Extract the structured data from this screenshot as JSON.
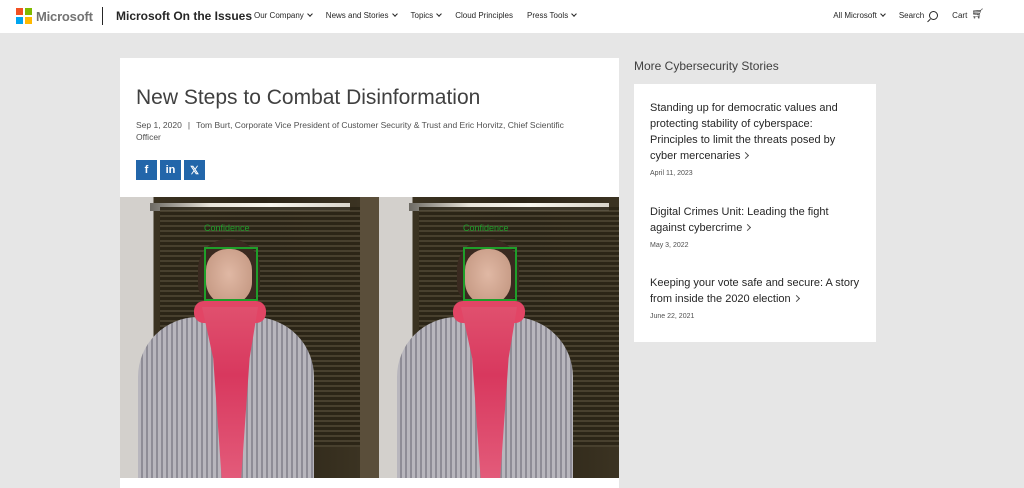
{
  "header": {
    "brand": "Microsoft",
    "site_title": "Microsoft On the Issues",
    "nav": [
      {
        "label": "Our Company",
        "dropdown": true
      },
      {
        "label": "News and Stories",
        "dropdown": true
      },
      {
        "label": "Topics",
        "dropdown": true
      },
      {
        "label": "Cloud Principles",
        "dropdown": false
      },
      {
        "label": "Press Tools",
        "dropdown": true
      }
    ],
    "all_microsoft": "All Microsoft",
    "search": "Search",
    "cart": "Cart"
  },
  "article": {
    "title": "New Steps to Combat Disinformation",
    "date": "Sep 1, 2020",
    "separator": "|",
    "authors": "Tom Burt, Corporate Vice President of Customer Security & Trust and Eric Horvitz, Chief Scientific Officer",
    "share": [
      {
        "icon": "facebook-icon",
        "glyph": "f"
      },
      {
        "icon": "linkedin-icon",
        "glyph": "in"
      },
      {
        "icon": "x-twitter-icon",
        "glyph": "𝕏"
      }
    ],
    "image_overlay_text": "Confidence"
  },
  "sidebar": {
    "heading": "More Cybersecurity Stories",
    "stories": [
      {
        "title": "Standing up for democratic values and protecting stability of cyberspace: Principles to limit the threats posed by cyber mercenaries",
        "date": "April 11, 2023"
      },
      {
        "title": "Digital Crimes Unit: Leading the fight against cybercrime",
        "date": "May 3, 2022"
      },
      {
        "title": "Keeping your vote safe and secure: A story from inside the 2020 election",
        "date": "June 22, 2021"
      }
    ]
  },
  "colors": {
    "page_bg": "#e6e6e6",
    "share_blue": "#2266aa",
    "face_box_green": "#1f9e2a"
  }
}
